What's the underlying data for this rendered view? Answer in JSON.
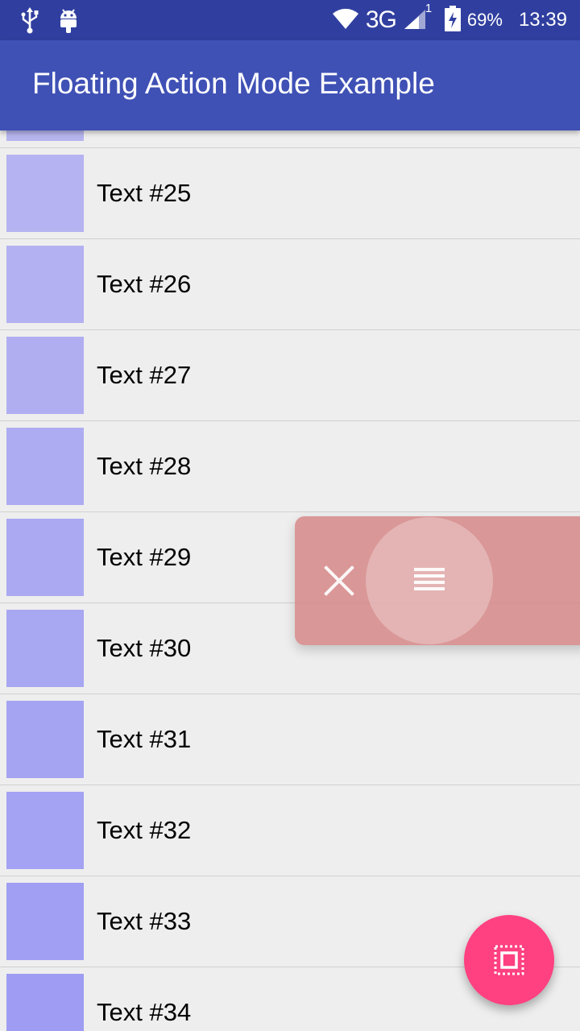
{
  "status_bar": {
    "network": "3G",
    "signal_superscript": "1",
    "battery": "69%",
    "time": "13:39"
  },
  "app_bar": {
    "title": "Floating Action Mode Example"
  },
  "list": {
    "items": [
      {
        "label": "",
        "thumb_color": "#b7b5ef"
      },
      {
        "label": "Text #25",
        "thumb_color": "#b5b3f1"
      },
      {
        "label": "Text #26",
        "thumb_color": "#b3b1f1"
      },
      {
        "label": "Text #27",
        "thumb_color": "#b0aef1"
      },
      {
        "label": "Text #28",
        "thumb_color": "#adacf2"
      },
      {
        "label": "Text #29",
        "thumb_color": "#aaa9f2"
      },
      {
        "label": "Text #30",
        "thumb_color": "#a8a7f2"
      },
      {
        "label": "Text #31",
        "thumb_color": "#a5a4f2"
      },
      {
        "label": "Text #32",
        "thumb_color": "#a3a2f3"
      },
      {
        "label": "Text #33",
        "thumb_color": "#a09ff3"
      },
      {
        "label": "Text #34",
        "thumb_color": "#9e9df3"
      }
    ]
  },
  "action_mode": {
    "close_icon": "close-icon",
    "list_icon": "list-icon",
    "background": "#d68484"
  },
  "fab": {
    "icon": "select-all-icon",
    "color": "#ff4081"
  },
  "colors": {
    "status_bar": "#303f9f",
    "app_bar": "#3f51b5",
    "background": "#eeeeee"
  }
}
